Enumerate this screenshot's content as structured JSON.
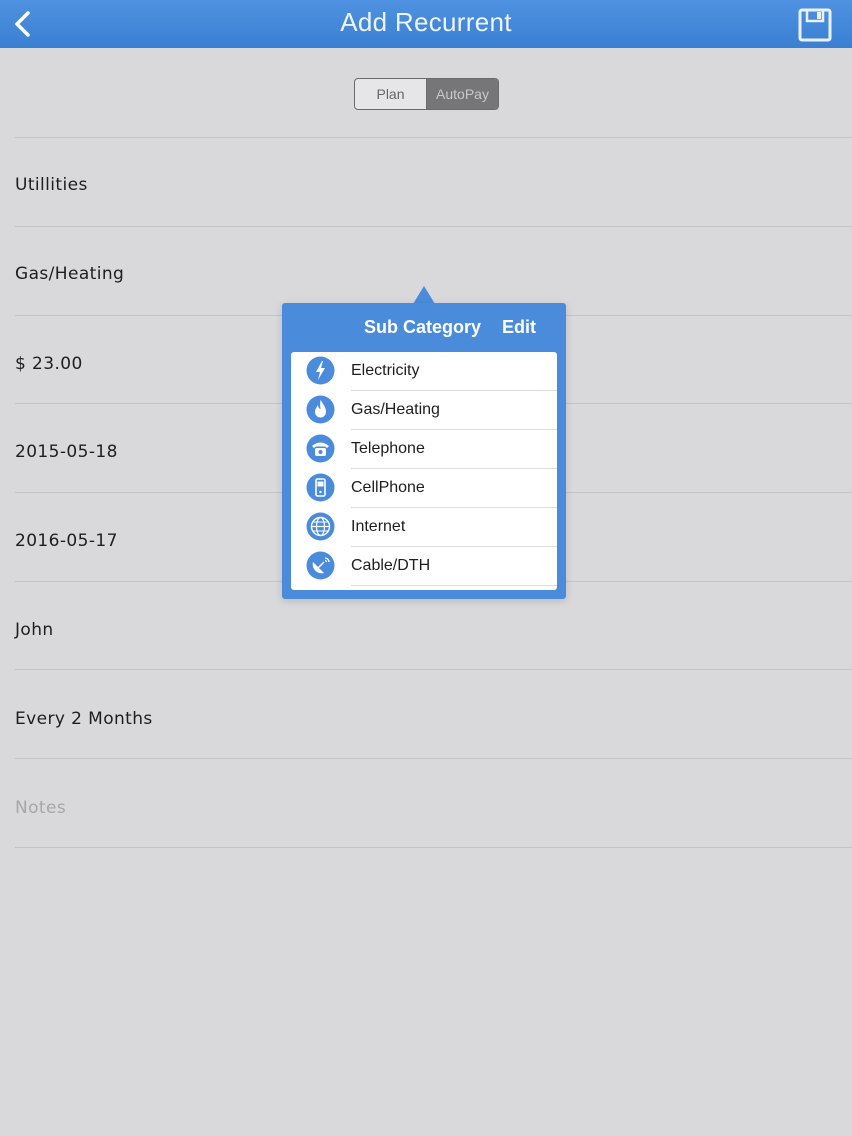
{
  "navbar": {
    "title": "Add Recurrent",
    "back_icon": "chevron-left-icon",
    "save_icon": "floppy-disk-icon"
  },
  "segmented": {
    "options": [
      "Plan",
      "AutoPay"
    ],
    "selected": "AutoPay"
  },
  "form": {
    "category": "Utillities",
    "sub_category": "Gas/Heating",
    "amount": "$ 23.00",
    "start_date": "2015-05-18",
    "end_date": "2016-05-17",
    "payee": "John",
    "frequency": "Every 2 Months",
    "notes_placeholder": "Notes"
  },
  "popover": {
    "title": "Sub Category",
    "edit_label": "Edit",
    "items": [
      {
        "label": "Electricity",
        "icon": "lightning-icon"
      },
      {
        "label": "Gas/Heating",
        "icon": "flame-icon"
      },
      {
        "label": "Telephone",
        "icon": "telephone-icon"
      },
      {
        "label": "CellPhone",
        "icon": "cellphone-icon"
      },
      {
        "label": "Internet",
        "icon": "globe-icon"
      },
      {
        "label": "Cable/DTH",
        "icon": "satellite-dish-icon"
      }
    ]
  },
  "colors": {
    "navbar": "#4a8cdb",
    "popover": "#4a8cdb",
    "background": "#d9d9dc",
    "icon_blue": "#4a8cdb"
  }
}
